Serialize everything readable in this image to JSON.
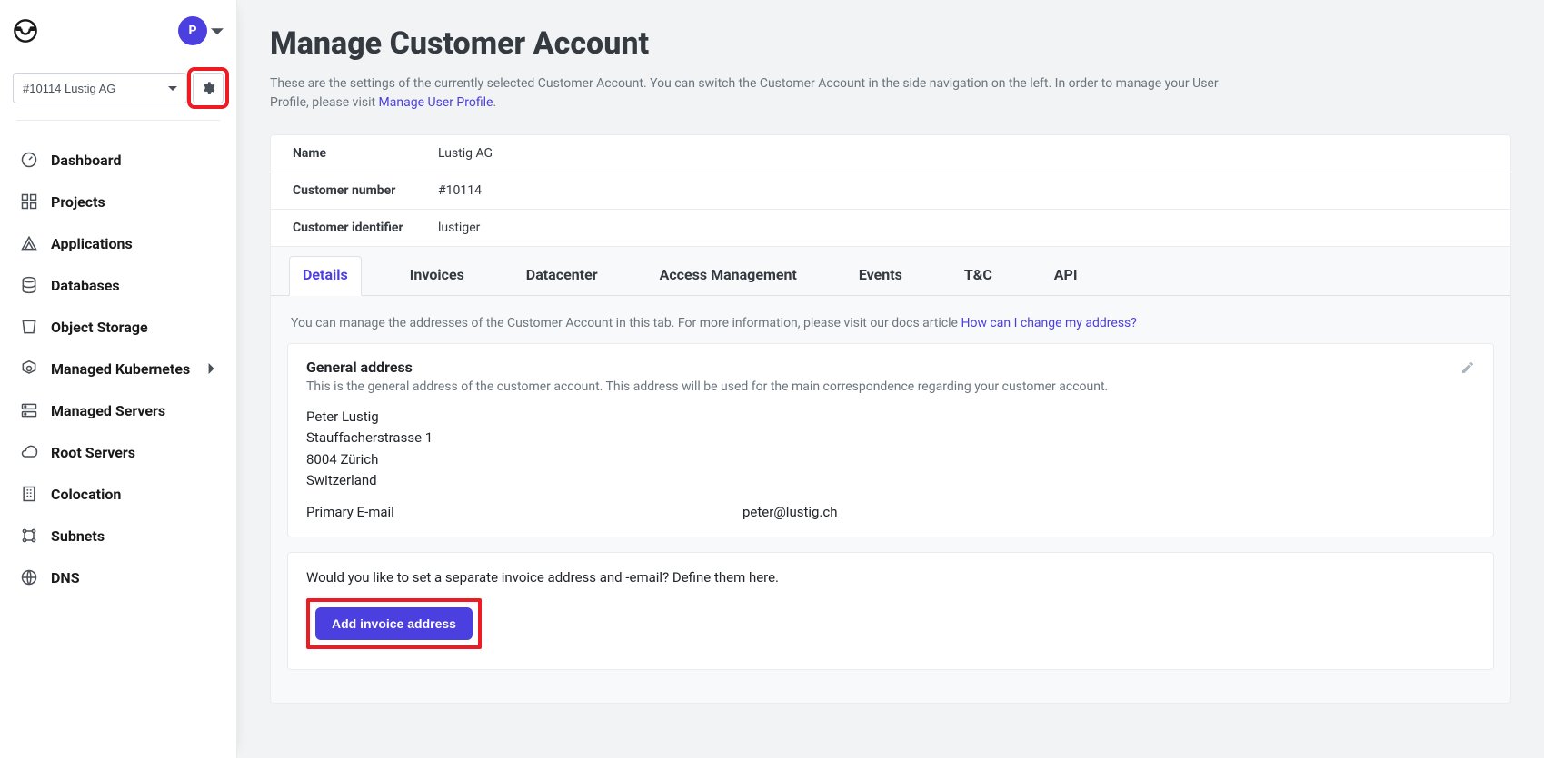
{
  "header": {
    "avatar_initial": "P"
  },
  "sidebar": {
    "account_selector": "#10114 Lustig AG",
    "items": [
      {
        "label": "Dashboard"
      },
      {
        "label": "Projects"
      },
      {
        "label": "Applications"
      },
      {
        "label": "Databases"
      },
      {
        "label": "Object Storage"
      },
      {
        "label": "Managed Kubernetes",
        "expandable": true
      },
      {
        "label": "Managed Servers"
      },
      {
        "label": "Root Servers"
      },
      {
        "label": "Colocation"
      },
      {
        "label": "Subnets"
      },
      {
        "label": "DNS"
      }
    ]
  },
  "page": {
    "title": "Manage Customer Account",
    "subtitle_a": "These are the settings of the currently selected Customer Account. You can switch the Customer Account in the side navigation on the left. In order to manage your User Profile, please visit ",
    "subtitle_link": "Manage User Profile",
    "subtitle_b": "."
  },
  "info": {
    "rows": [
      {
        "label": "Name",
        "value": "Lustig AG"
      },
      {
        "label": "Customer number",
        "value": "#10114"
      },
      {
        "label": "Customer identifier",
        "value": "lustiger"
      }
    ]
  },
  "tabs": [
    "Details",
    "Invoices",
    "Datacenter",
    "Access Management",
    "Events",
    "T&C",
    "API"
  ],
  "details": {
    "help_text": "You can manage the addresses of the Customer Account in this tab. For more information, please visit our docs article ",
    "help_link": "How can I change my address?",
    "general": {
      "title": "General address",
      "desc": "This is the general address of the customer account. This address will be used for the main correspondence regarding your customer account.",
      "lines": [
        "Peter Lustig",
        "Stauffacherstrasse 1",
        "8004 Zürich",
        "Switzerland"
      ],
      "email_label": "Primary E-mail",
      "email_value": "peter@lustig.ch"
    },
    "invoice_prompt": "Would you like to set a separate invoice address and -email? Define them here.",
    "add_button": "Add invoice address"
  }
}
